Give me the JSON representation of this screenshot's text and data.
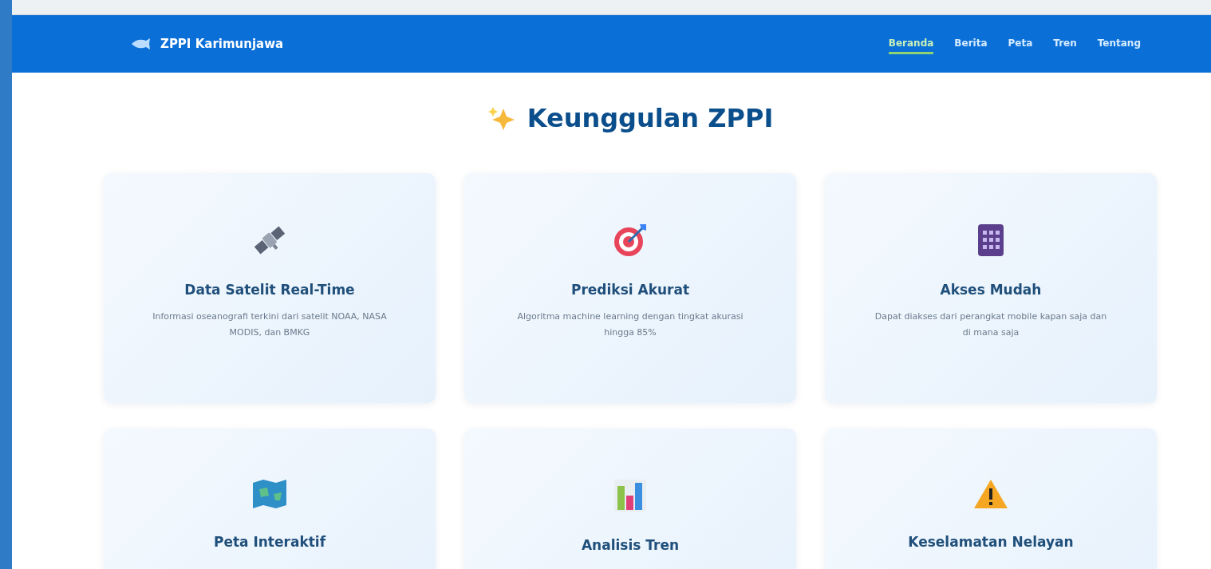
{
  "header": {
    "brand": "ZPPI Karimunjawa",
    "nav": [
      {
        "label": "Beranda",
        "selected": true
      },
      {
        "label": "Berita",
        "selected": false
      },
      {
        "label": "Peta",
        "selected": false
      },
      {
        "label": "Tren",
        "selected": false
      },
      {
        "label": "Tentang",
        "selected": false
      }
    ]
  },
  "section": {
    "title": "Keunggulan ZPPI",
    "features": [
      {
        "kind": "satellite",
        "title": "Data Satelit Real-Time",
        "description": "Informasi oseanografi terkini dari satelit NOAA, NASA MODIS, dan BMKG"
      },
      {
        "kind": "target",
        "title": "Prediksi Akurat",
        "description": "Algoritma machine learning dengan tingkat akurasi hingga 85%"
      },
      {
        "kind": "phone",
        "title": "Akses Mudah",
        "description": "Dapat diakses dari perangkat mobile kapan saja dan di mana saja"
      },
      {
        "kind": "map",
        "title": "Peta Interaktif"
      },
      {
        "kind": "chart",
        "title": "Analisis Tren"
      },
      {
        "kind": "warning",
        "title": "Keselamatan Nelayan"
      }
    ]
  }
}
